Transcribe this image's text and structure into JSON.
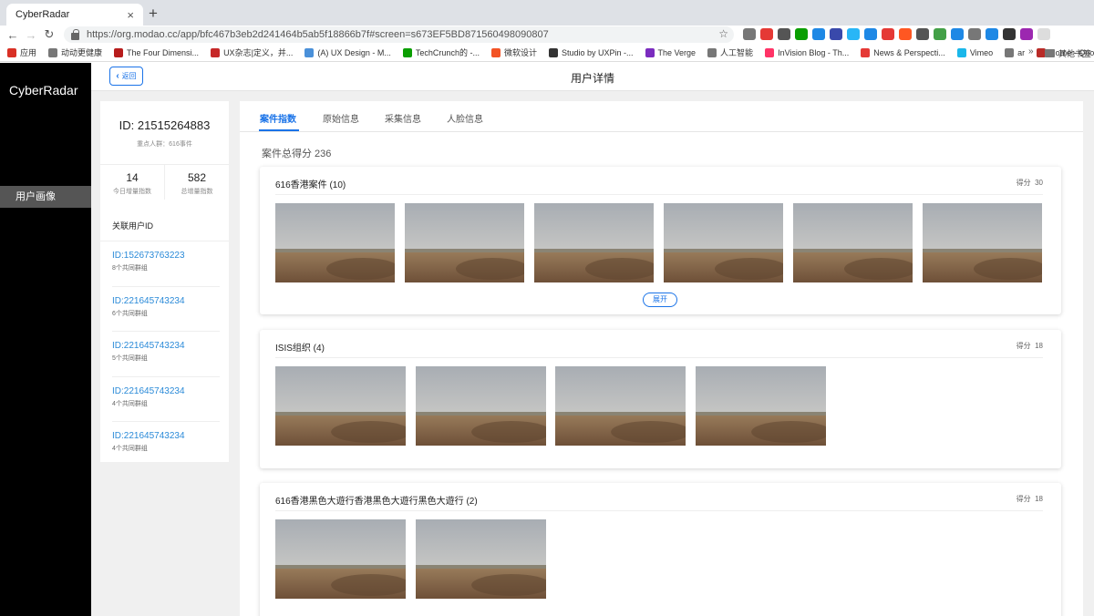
{
  "browser": {
    "tab_title": "CyberRadar",
    "tab_close": "×",
    "new_tab": "+",
    "url": "https://org.modao.cc/app/bfc467b3eb2d241464b5ab5f18866b7f#screen=s673EF5BD871560498090807",
    "bookmarks": [
      {
        "label": "应用",
        "color": "#d93025"
      },
      {
        "label": "动动更健康",
        "color": "#777777"
      },
      {
        "label": "The Four Dimensi...",
        "color": "#b71c1c"
      },
      {
        "label": "UX杂志|定义，并...",
        "color": "#c62828"
      },
      {
        "label": "(A) UX Design - M...",
        "color": "#4a90d9"
      },
      {
        "label": "TechCrunch的 -...",
        "color": "#0a9e01"
      },
      {
        "label": "微软设计",
        "color": "#f35325"
      },
      {
        "label": "Studio by UXPin -...",
        "color": "#333333"
      },
      {
        "label": "The Verge",
        "color": "#7b2cbf"
      },
      {
        "label": "人工智能",
        "color": "#777777"
      },
      {
        "label": "InVision Blog - Th...",
        "color": "#ff3366"
      },
      {
        "label": "News & Perspecti...",
        "color": "#e53935"
      },
      {
        "label": "Vimeo",
        "color": "#1ab7ea"
      },
      {
        "label": "ar",
        "color": "#777777"
      },
      {
        "label": "Home - Quora",
        "color": "#b92b27"
      }
    ],
    "bookmarks_more": "»",
    "bookmarks_other": "其他书签",
    "extension_colors": [
      "#777777",
      "#e53935",
      "#555555",
      "#0a9e01",
      "#1e88e5",
      "#3949ab",
      "#29b6f6",
      "#1e88e5",
      "#e53935",
      "#ff5722",
      "#555555",
      "#43a047",
      "#1e88e5",
      "#777777",
      "#1e88e5",
      "#333333",
      "#9c27b0",
      "#dddddd"
    ]
  },
  "sidebar": {
    "brand": "CyberRadar",
    "active_item": "用户画像"
  },
  "header": {
    "back_label": "返回",
    "title": "用户详情"
  },
  "profile": {
    "id_text": "ID: 21515264883",
    "tag": "重点人群：616事件",
    "stats": [
      {
        "value": "14",
        "label": "今日增量指数"
      },
      {
        "value": "582",
        "label": "总增量指数"
      }
    ]
  },
  "related": {
    "title": "关联用户ID",
    "items": [
      {
        "id": "ID:152673763223",
        "groups": "8个共同群组"
      },
      {
        "id": "ID:221645743234",
        "groups": "6个共同群组"
      },
      {
        "id": "ID:221645743234",
        "groups": "5个共同群组"
      },
      {
        "id": "ID:221645743234",
        "groups": "4个共同群组"
      },
      {
        "id": "ID:221645743234",
        "groups": "4个共同群组"
      }
    ]
  },
  "detail": {
    "tabs": [
      "案件指数",
      "原始信息",
      "采集信息",
      "人脸信息"
    ],
    "active_tab": "案件指数",
    "total_score": "案件总得分 236",
    "cases": [
      {
        "title": "616香港案件 (10)",
        "score_label": "得分",
        "score": "30",
        "thumbnails": 6,
        "expand_label": "展开"
      },
      {
        "title": "ISIS组织 (4)",
        "score_label": "得分",
        "score": "18",
        "thumbnails": 4
      },
      {
        "title": "616香港黑色大遊行香港黑色大遊行黑色大遊行 (2)",
        "score_label": "得分",
        "score": "18",
        "thumbnails": 2
      }
    ]
  }
}
